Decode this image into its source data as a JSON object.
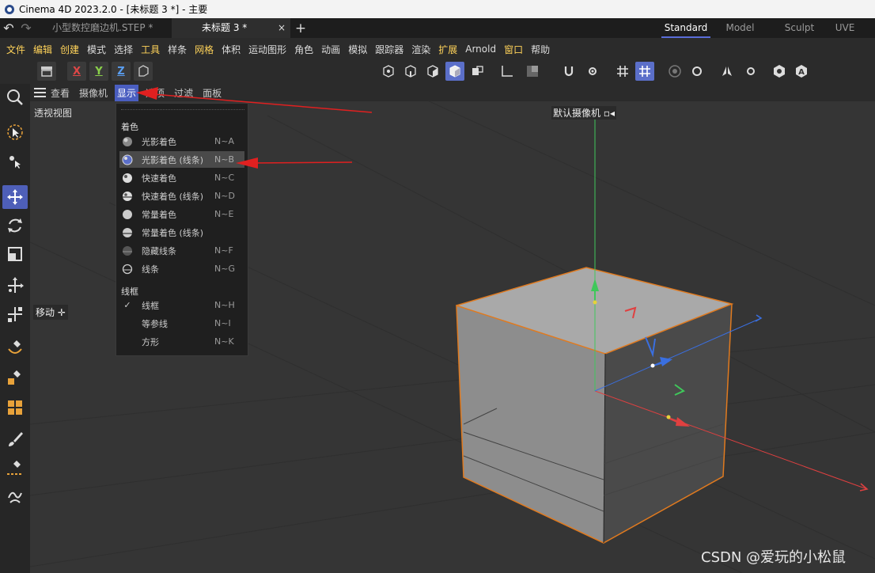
{
  "titlebar": {
    "title": "Cinema 4D 2023.2.0 - [未标题 3 *] - 主要"
  },
  "tabs": {
    "doc1": "小型数控磨边机.STEP *",
    "doc2": "未标题 3 *",
    "close": "×",
    "add": "+",
    "layouts": [
      "Standard",
      "Model",
      "Sculpt",
      "UVE"
    ]
  },
  "menubar": {
    "items": [
      "文件",
      "编辑",
      "创建",
      "模式",
      "选择",
      "工具",
      "样条",
      "网格",
      "体积",
      "运动图形",
      "角色",
      "动画",
      "模拟",
      "跟踪器",
      "渲染",
      "扩展",
      "Arnold",
      "窗口",
      "帮助"
    ]
  },
  "toolbar": {
    "x": "X",
    "y": "Y",
    "z": "Z"
  },
  "viewport": {
    "menus": [
      "查看",
      "摄像机",
      "显示",
      "选项",
      "过滤",
      "面板"
    ],
    "view_label": "透视视图",
    "camera_label": "默认摄像机",
    "move_label": "移动"
  },
  "dropdown": {
    "section_shading": "着色",
    "section_wire": "线框",
    "items": [
      {
        "label": "光影着色",
        "shortcut": "N~A"
      },
      {
        "label": "光影着色 (线条)",
        "shortcut": "N~B"
      },
      {
        "label": "快速着色",
        "shortcut": "N~C"
      },
      {
        "label": "快速着色 (线条)",
        "shortcut": "N~D"
      },
      {
        "label": "常量着色",
        "shortcut": "N~E"
      },
      {
        "label": "常量着色 (线条)",
        "shortcut": ""
      },
      {
        "label": "隐藏线条",
        "shortcut": "N~F"
      },
      {
        "label": "线条",
        "shortcut": "N~G"
      }
    ],
    "wire_items": [
      {
        "label": "线框",
        "shortcut": "N~H",
        "checked": true
      },
      {
        "label": "等参线",
        "shortcut": "N~I"
      },
      {
        "label": "方形",
        "shortcut": "N~K"
      }
    ],
    "check": "✓"
  },
  "watermark": "CSDN @爱玩的小松鼠",
  "colors": {
    "accent": "#5b6fc9",
    "selection_outline": "#e07a1f",
    "arrow": "#e02020"
  }
}
